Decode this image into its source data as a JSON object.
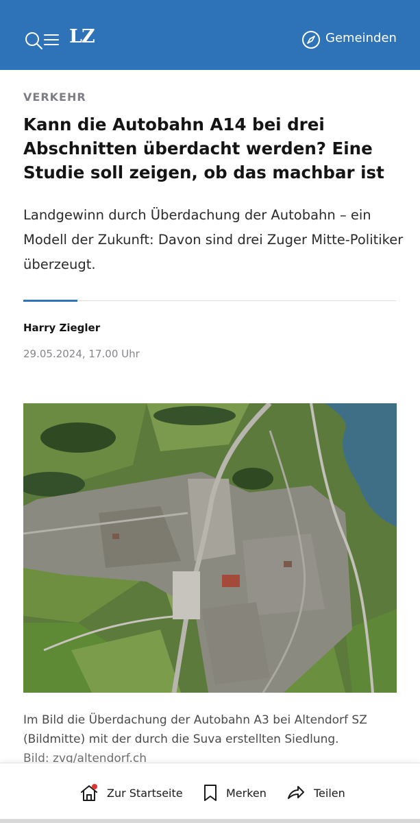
{
  "header": {
    "logo": "LZ",
    "communities_label": "Gemeinden",
    "brand_color": "#2e73b8",
    "icons": [
      "search-icon",
      "menu-icon",
      "compass-icon"
    ]
  },
  "article": {
    "kicker": "VERKEHR",
    "headline": "Kann die Autobahn A14 bei drei Abschnitten überdacht werden? Eine Studie soll zeigen, ob das machbar ist",
    "lead": "Landgewinn durch Überdachung der Autobahn – ein Modell der Zukunft: Davon sind drei Zuger Mitte-Politiker überzeugt.",
    "author": "Harry Ziegler",
    "date": "29.05.2024, 17.00 Uhr",
    "image_caption": "Im Bild die Überdachung der Autobahn A3 bei Altendorf SZ (Bildmitte) mit der durch die Suva erstellten Siedlung.",
    "image_credit": "Bild: zvg/altendorf.ch"
  },
  "bottom_bar": {
    "home_label": "Zur Startseite",
    "bookmark_label": "Merken",
    "share_label": "Teilen",
    "icons": [
      "home-icon",
      "bookmark-icon",
      "share-icon"
    ]
  }
}
